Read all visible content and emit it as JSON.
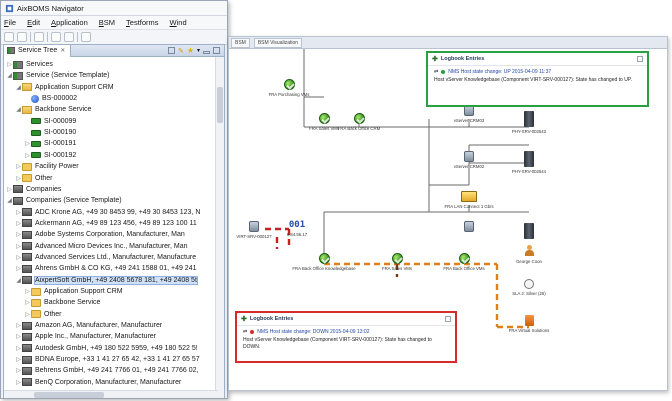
{
  "app": {
    "title": "AixBOMS Navigator",
    "menu": [
      "File",
      "Edit",
      "Application",
      "BSM",
      "Testforms",
      "Wind"
    ]
  },
  "service_tree": {
    "tab_label": "Service Tree",
    "rows": [
      {
        "label": "Services",
        "indent": 0,
        "icon": "services-icon",
        "twisty": "▷"
      },
      {
        "label": "Service (Service Template)",
        "indent": 0,
        "icon": "services-icon",
        "twisty": "◢"
      },
      {
        "label": "Application Support CRM",
        "indent": 1,
        "icon": "folder-open",
        "twisty": "◢"
      },
      {
        "label": "BS-000002",
        "indent": 2,
        "icon": "blue",
        "twisty": ""
      },
      {
        "label": "Backbone Service",
        "indent": 1,
        "icon": "folder-open",
        "twisty": "◢"
      },
      {
        "label": "SI-000099",
        "indent": 2,
        "icon": "green",
        "twisty": ""
      },
      {
        "label": "SI-000190",
        "indent": 2,
        "icon": "green",
        "twisty": ""
      },
      {
        "label": "SI-000191",
        "indent": 2,
        "icon": "green",
        "twisty": "▷"
      },
      {
        "label": "SI-000192",
        "indent": 2,
        "icon": "green",
        "twisty": "▷"
      },
      {
        "label": "Facility Power",
        "indent": 1,
        "icon": "folder",
        "twisty": "▷"
      },
      {
        "label": "Other",
        "indent": 1,
        "icon": "folder",
        "twisty": "▷"
      },
      {
        "label": "Companies",
        "indent": 0,
        "icon": "building",
        "twisty": "▷"
      },
      {
        "label": "Companies (Service Template)",
        "indent": 0,
        "icon": "building",
        "twisty": "◢"
      },
      {
        "label": "ADC Krone AG, +49 30 8453 99, +49 30 8453 123, N",
        "indent": 1,
        "icon": "building",
        "twisty": "▷"
      },
      {
        "label": "Ackermann AG, +49 89 123 456, +49 89 123 100 11",
        "indent": 1,
        "icon": "building",
        "twisty": "▷"
      },
      {
        "label": "Adobe Systems Corporation, Manufacturer, Man",
        "indent": 1,
        "icon": "building",
        "twisty": "▷"
      },
      {
        "label": "Advanced Micro Devices Inc., Manufacturer, Man",
        "indent": 1,
        "icon": "building",
        "twisty": "▷"
      },
      {
        "label": "Advanced Services Ltd., Manufacturer, Manufacture",
        "indent": 1,
        "icon": "building",
        "twisty": "▷"
      },
      {
        "label": "Ahrens GmbH & CO KG, +49 241 1588 01, +49 241",
        "indent": 1,
        "icon": "building",
        "twisty": "▷"
      },
      {
        "label": "AixpertSoft GmbH, +49 2408 5678 181, +49 2408 5t",
        "indent": 1,
        "icon": "building",
        "twisty": "◢",
        "selected": true
      },
      {
        "label": "Application Support CRM",
        "indent": 2,
        "icon": "folder",
        "twisty": "▷"
      },
      {
        "label": "Backbone Service",
        "indent": 2,
        "icon": "folder",
        "twisty": "▷"
      },
      {
        "label": "Other",
        "indent": 2,
        "icon": "folder",
        "twisty": "▷"
      },
      {
        "label": "Amazon AG, Manufacturer, Manufacturer",
        "indent": 1,
        "icon": "building",
        "twisty": "▷"
      },
      {
        "label": "Apple Inc., Manufacturer, Manufacturer",
        "indent": 1,
        "icon": "building",
        "twisty": "▷"
      },
      {
        "label": "Autodesk GmbH, +49 180 522 5959, +49 180 522 5!",
        "indent": 1,
        "icon": "building",
        "twisty": "▷"
      },
      {
        "label": "BDNA Europe, +33 1 41 27 65 42, +33 1 41 27 65 57",
        "indent": 1,
        "icon": "building",
        "twisty": "▷"
      },
      {
        "label": "Behrens GmbH, +49 241 7766 01, +49 241 7766 02,",
        "indent": 1,
        "icon": "building",
        "twisty": "▷"
      },
      {
        "label": "BenQ Corporation, Manufacturer, Manufacturer",
        "indent": 1,
        "icon": "building",
        "twisty": "▷"
      }
    ]
  },
  "bsm": {
    "tabs": [
      "BSM",
      "BSM Visualization"
    ],
    "nodes": [
      {
        "id": "fpv",
        "label": "FRA Purchasing VMs",
        "kind": "gnode"
      },
      {
        "id": "fsv",
        "label": "FRA Sales VMs",
        "kind": "gnode"
      },
      {
        "id": "fbo",
        "label": "FRA Back Office CRM",
        "kind": "gnode"
      },
      {
        "id": "vs3",
        "label": "vServer CRM03",
        "kind": "vserver"
      },
      {
        "id": "ph3",
        "label": "PHY-SRV-002543",
        "kind": "server"
      },
      {
        "id": "vs2",
        "label": "vServer CRM02",
        "kind": "vserver"
      },
      {
        "id": "ph4",
        "label": "PHY-SRV-002544",
        "kind": "server"
      },
      {
        "id": "lan",
        "label": "FRA LAN Connect 1 Gb/s",
        "kind": "vm-box"
      },
      {
        "id": "vs4",
        "label": "",
        "kind": "vserver"
      },
      {
        "id": "ph5",
        "label": "",
        "kind": "server"
      },
      {
        "id": "vsrv",
        "label": "VIRT-SRV-000127",
        "kind": "vserver"
      },
      {
        "id": "d001",
        "label": "6.84.56.17",
        "kind": "digits"
      },
      {
        "id": "fbk",
        "label": "FRA Back Office Knowledgebase",
        "kind": "gnode"
      },
      {
        "id": "fsv2",
        "label": "FRA Sales VMs",
        "kind": "gnode"
      },
      {
        "id": "fbv",
        "label": "FRA Back Office VMs",
        "kind": "gnode"
      },
      {
        "id": "gc",
        "label": "George Coon",
        "kind": "person"
      },
      {
        "id": "sla",
        "label": "SLA 2: Silver (26)",
        "kind": "clock"
      },
      {
        "id": "fvs",
        "label": "FRA Virtual Solutions",
        "kind": "vsol"
      }
    ],
    "digits_text": "001",
    "popup_up": {
      "title": "Logbook Entries",
      "entry": "NMS Host state change: UP 2015-04-09 11:37",
      "text": "Host vServer Knowledgebase (Component VIRT-SRV-000127): State has changed to UP.",
      "color": "#2aa042"
    },
    "popup_down": {
      "title": "Logbook Entries",
      "entry": "NMS Host state change: DOWN 2015-04-09 13:02",
      "text": "Host vServer Knowledgebase (Component VIRT-SRV-000127): State has changed to DOWN.",
      "color": "#d72a2a"
    }
  }
}
